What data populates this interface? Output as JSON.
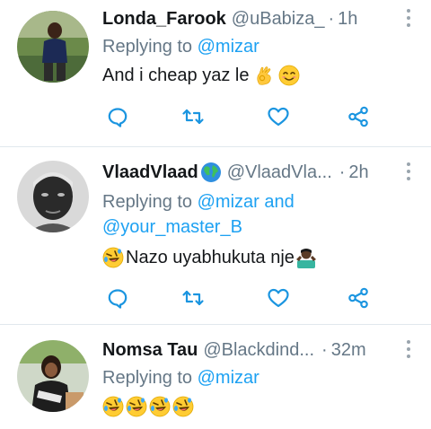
{
  "tweets": [
    {
      "name": "Londa_Farook",
      "handle": "@uBabiza_",
      "dot": "·",
      "time": "1h",
      "replying_prefix": "Replying to",
      "mention_1": "@mizar",
      "text": "And i cheap yaz le",
      "text_emojis": [
        "ok-hand-icon",
        "smiling-face-icon"
      ]
    },
    {
      "name": "VlaadVlaad",
      "name_emoji": "globe-icon",
      "handle": "@VlaadVla...",
      "dot": "·",
      "time": "2h",
      "replying_prefix": "Replying to",
      "mention_1": "@mizar",
      "conjunction": "and",
      "mention_2": "@your_master_B",
      "text": "Nazo uyabhukuta nje",
      "text_emojis": [
        "rofl-icon",
        "shrug-icon"
      ]
    },
    {
      "name": "Nomsa Tau",
      "handle": "@Blackdind...",
      "dot": "·",
      "time": "32m",
      "replying_prefix": "Replying to",
      "mention_1": "@mizar",
      "text": "",
      "text_emojis": [
        "rofl-icon",
        "rofl-icon",
        "rofl-icon",
        "rofl-icon"
      ]
    }
  ],
  "actions": [
    "reply-icon",
    "retweet-icon",
    "like-icon",
    "share-icon"
  ],
  "colors": {
    "link": "#1da1f2",
    "secondary": "#657786",
    "text": "#14171a",
    "separator": "#e1e8ed",
    "icon": "#1b95e0"
  }
}
